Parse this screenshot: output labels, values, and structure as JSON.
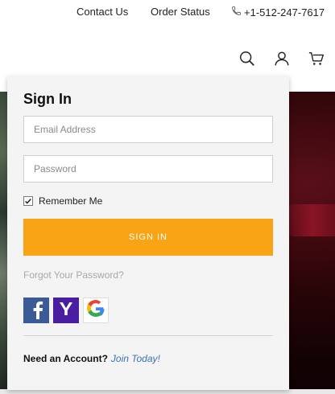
{
  "topbar": {
    "contact_label": "Contact Us",
    "order_label": "Order Status",
    "phone": "+1-512-247-7617"
  },
  "header": {
    "icons": [
      "search-icon",
      "account-icon",
      "cart-icon"
    ]
  },
  "signin": {
    "title": "Sign In",
    "email_placeholder": "Email Address",
    "password_placeholder": "Password",
    "remember_label": "Remember Me",
    "remember_checked": true,
    "button_label": "SIGN IN",
    "forgot_label": "Forgot Your Password?",
    "social": [
      "facebook-icon",
      "yahoo-icon",
      "google-icon"
    ],
    "need_account_label": "Need an Account?",
    "join_label": "Join Today!"
  },
  "colors": {
    "accent_orange": "#f8a414",
    "link_blue": "#3b72b8",
    "facebook": "#3b5b98",
    "yahoo": "#4a1ea0"
  }
}
